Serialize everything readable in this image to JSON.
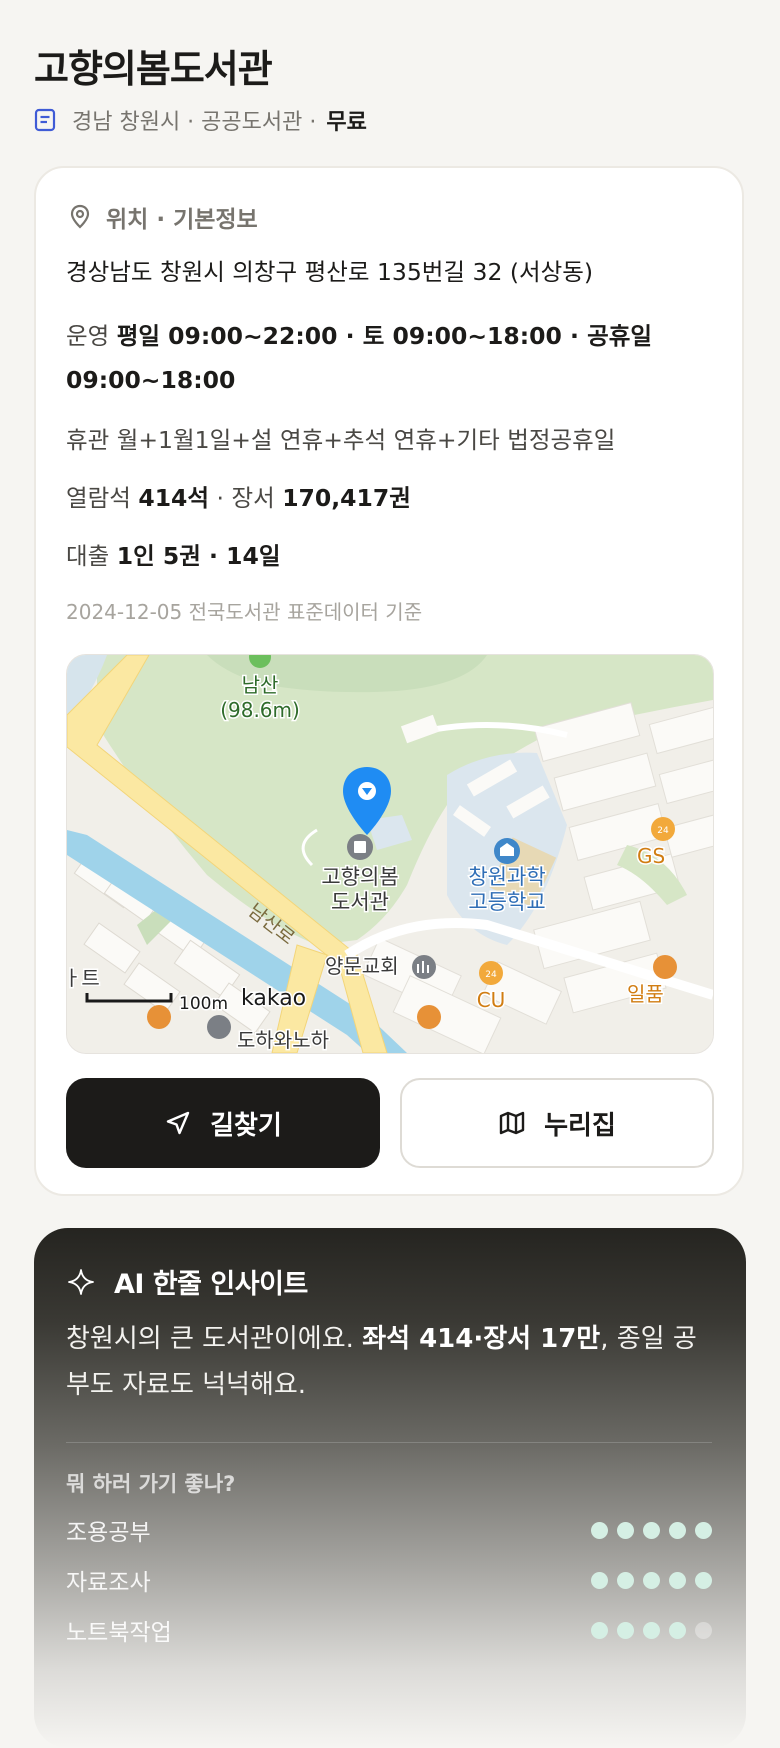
{
  "header": {
    "title": "고향의봄도서관",
    "meta": "경남 창원시 · 공공도서관 ·",
    "fee": "무료"
  },
  "info": {
    "section_title": "위치 · 기본정보",
    "address": "경상남도 창원시 의창구 평산로 135번길 32 (서상동)",
    "hours_label": "운영",
    "hours_line1": "평일 09:00~22:00 · 토 09:00~18:00 · 공휴일",
    "hours_line2": "09:00~18:00",
    "closed_label": "휴관",
    "closed_value": "월+1월1일+설 연휴+추석 연휴+기타 법정공휴일",
    "seats_label": "열람석",
    "seats_value": "414석",
    "books_sep": "· 장서",
    "books_value": "170,417권",
    "loan_label": "대출",
    "loan_value": "1인 5권 · 14일",
    "source": "2024-12-05 전국도서관 표준데이터 기준"
  },
  "map": {
    "labels": {
      "mountain": "남산",
      "mountain_alt": "(98.6m)",
      "library_line1": "고향의봄",
      "library_line2": "도서관",
      "school_line1": "창원과학",
      "school_line2": "고등학교",
      "road": "남산로",
      "church": "양문교회",
      "store_cu": "CU",
      "store_gs": "GS",
      "store_24a": "24",
      "store_24b": "24",
      "partial_left": "ㅏ트",
      "partial_right": "일품",
      "partial_bottom": "도하와노하",
      "scale": "100m",
      "brand": "kakao"
    }
  },
  "actions": {
    "directions": "길찾기",
    "homepage": "누리집"
  },
  "ai": {
    "title": "AI 한줄 인사이트",
    "text_pre": "창원시의 큰 도서관이에요. ",
    "text_bold": "좌석 414·장서 17만",
    "text_post": ", 종일 공부도 자료도 넉넉해요.",
    "question": "뭐 하러 가기 좋나?",
    "ratings": [
      {
        "label": "조용공부",
        "score": 5,
        "max": 5
      },
      {
        "label": "자료조사",
        "score": 5,
        "max": 5
      },
      {
        "label": "노트북작업",
        "score": 4,
        "max": 5
      }
    ]
  },
  "colors": {
    "accent_dark": "#1c1b19",
    "pin_blue": "#1f8cf3",
    "rating_dot": "#d5efe4"
  }
}
